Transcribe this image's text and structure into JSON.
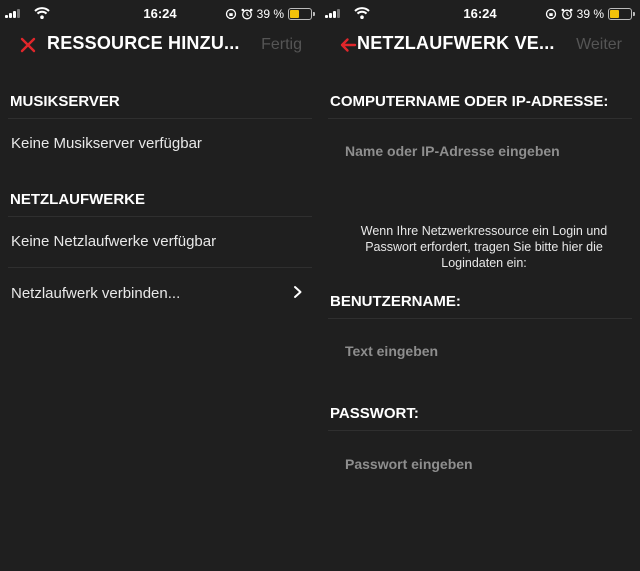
{
  "colors": {
    "background": "#1f1f1f",
    "accent_red": "#e0262b",
    "battery_yellow": "#f2c20b",
    "disabled_text": "#555555",
    "placeholder_text": "#8a8a8a"
  },
  "left": {
    "status": {
      "time": "16:24",
      "battery": "39 %"
    },
    "header": {
      "close_icon": "close-icon",
      "title": "RESSOURCE HINZU...",
      "action": "Fertig"
    },
    "sections": [
      {
        "heading": "MUSIKSERVER",
        "items": [
          "Keine Musikserver verfügbar"
        ]
      },
      {
        "heading": "NETZLAUFWERKE",
        "items": [
          "Keine Netzlaufwerke verfügbar",
          "Netzlaufwerk verbinden..."
        ]
      }
    ]
  },
  "right": {
    "status": {
      "time": "16:24",
      "battery": "39 %"
    },
    "header": {
      "back_icon": "back-arrow-icon",
      "title": "NETZLAUFWERK VE...",
      "action": "Weiter"
    },
    "computer_label": "COMPUTERNAME ODER IP-ADRESSE:",
    "computer_placeholder": "Name oder IP-Adresse eingeben",
    "info": "Wenn Ihre Netzwerkressource ein Login und Passwort erfordert, tragen Sie bitte hier die Logindaten ein:",
    "username_label": "BENUTZERNAME:",
    "username_placeholder": "Text eingeben",
    "password_label": "PASSWORT:",
    "password_placeholder": "Passwort eingeben"
  }
}
